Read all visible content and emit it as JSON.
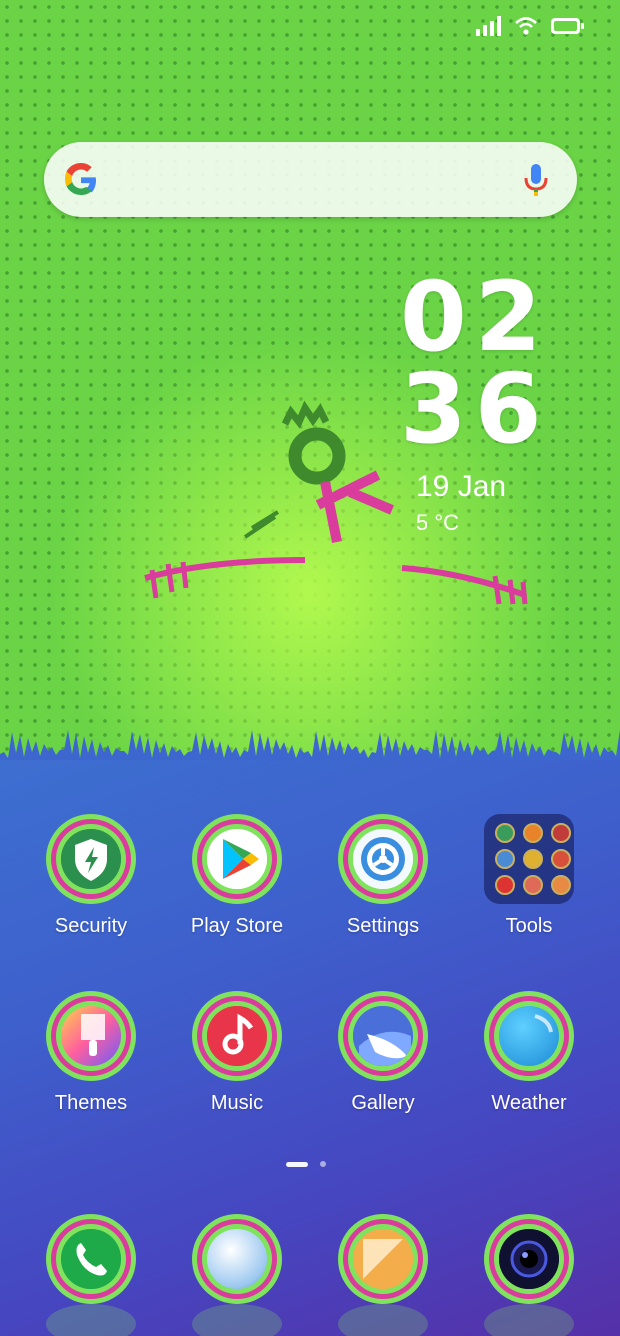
{
  "status_bar": {
    "icons": [
      "signal-icon",
      "wifi-icon",
      "battery-icon"
    ],
    "battery_color": "#6ad446"
  },
  "search_bar": {
    "logo": "google-logo",
    "mic": "mic-icon"
  },
  "clock_widget": {
    "hours": "02",
    "minutes": "36",
    "date": "19 Jan",
    "temperature": "5 °C"
  },
  "apps": [
    {
      "label": "Security",
      "icon": "security-shield-icon"
    },
    {
      "label": "Play Store",
      "icon": "play-store-icon"
    },
    {
      "label": "Settings",
      "icon": "settings-gear-icon"
    },
    {
      "label": "Tools",
      "icon": "tools-folder-icon"
    },
    {
      "label": "Themes",
      "icon": "themes-brush-icon"
    },
    {
      "label": "Music",
      "icon": "music-note-icon"
    },
    {
      "label": "Gallery",
      "icon": "gallery-icon"
    },
    {
      "label": "Weather",
      "icon": "weather-icon"
    }
  ],
  "page_indicator": {
    "pages": 2,
    "current": 1
  },
  "dock": [
    {
      "icon": "phone-icon"
    },
    {
      "icon": "browser-icon"
    },
    {
      "icon": "notes-icon"
    },
    {
      "icon": "camera-icon"
    }
  ],
  "colors": {
    "top_green": "#6ad446",
    "ring_green": "#7fe35e",
    "ring_pink": "#d93c9c",
    "bottom_blue": "#3e5fcc",
    "bottom_purple": "#5530a8"
  }
}
